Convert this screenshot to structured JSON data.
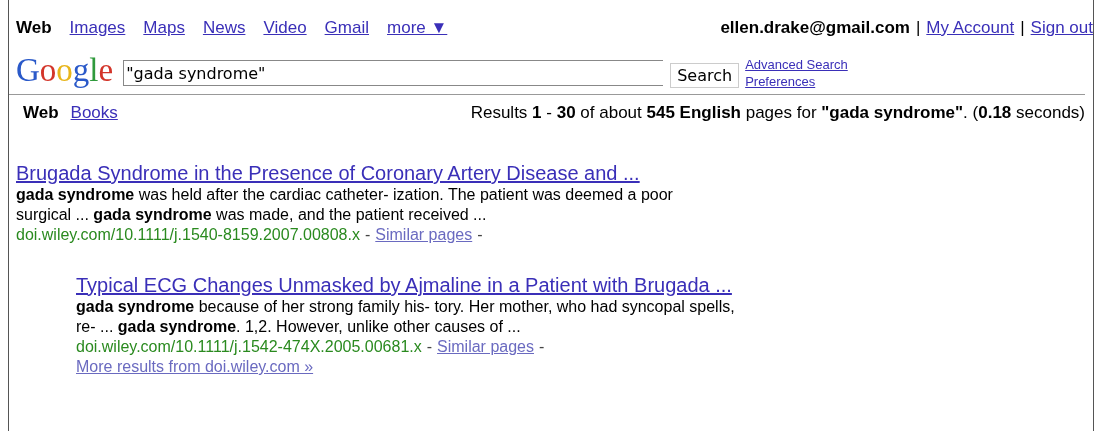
{
  "nav_tabs": [
    {
      "label": "Web",
      "selected": true
    },
    {
      "label": "Images",
      "selected": false
    },
    {
      "label": "Maps",
      "selected": false
    },
    {
      "label": "News",
      "selected": false
    },
    {
      "label": "Video",
      "selected": false
    },
    {
      "label": "Gmail",
      "selected": false
    },
    {
      "label": "more ▼",
      "selected": false
    }
  ],
  "account": [
    {
      "kind": "email",
      "label": "ellen.drake@gmail.com"
    },
    {
      "kind": "separator",
      "label": "|"
    },
    {
      "kind": "link",
      "label": "My Account"
    },
    {
      "kind": "separator",
      "label": "|"
    },
    {
      "kind": "link",
      "label": "Sign out"
    }
  ],
  "logo": "Google",
  "search": {
    "value": "\"gada syndrome\"",
    "button": "Search",
    "links": [
      "Advanced Search",
      "Preferences"
    ]
  },
  "result_tabs": [
    {
      "label": "Web",
      "selected": true
    },
    {
      "label": "Books",
      "selected": false
    }
  ],
  "results_summary": "Results **1** - **30** of about **545 English** pages for **\"gada syndrome\"**. (**0.18** seconds)",
  "results": [
    {
      "indented": false,
      "title": "Brugada Syndrome in the Presence of Coronary Artery Disease and ...",
      "snippet": [
        "**gada syndrome** was held after the cardiac catheter- ization. The patient was deemed a poor",
        "surgical ... **gada syndrome** was made, and the patient received ..."
      ],
      "url": "doi.wiley.com/10.1111/j.1540-8159.2007.00808.x",
      "url_separator": "-",
      "similar": "Similar pages",
      "trailing": "-"
    },
    {
      "indented": true,
      "title": "Typical ECG Changes Unmasked by Ajmaline in a Patient with Brugada ...",
      "snippet": [
        "**gada syndrome** because of her strong family his- tory. Her mother, who had syncopal spells,",
        "re- ... **gada syndrome**. 1,2. However, unlike other causes of ..."
      ],
      "url": "doi.wiley.com/10.1111/j.1542-474X.2005.00681.x",
      "url_separator": "-",
      "similar": "Similar pages",
      "trailing": "-",
      "more": "More results from doi.wiley.com »"
    }
  ]
}
